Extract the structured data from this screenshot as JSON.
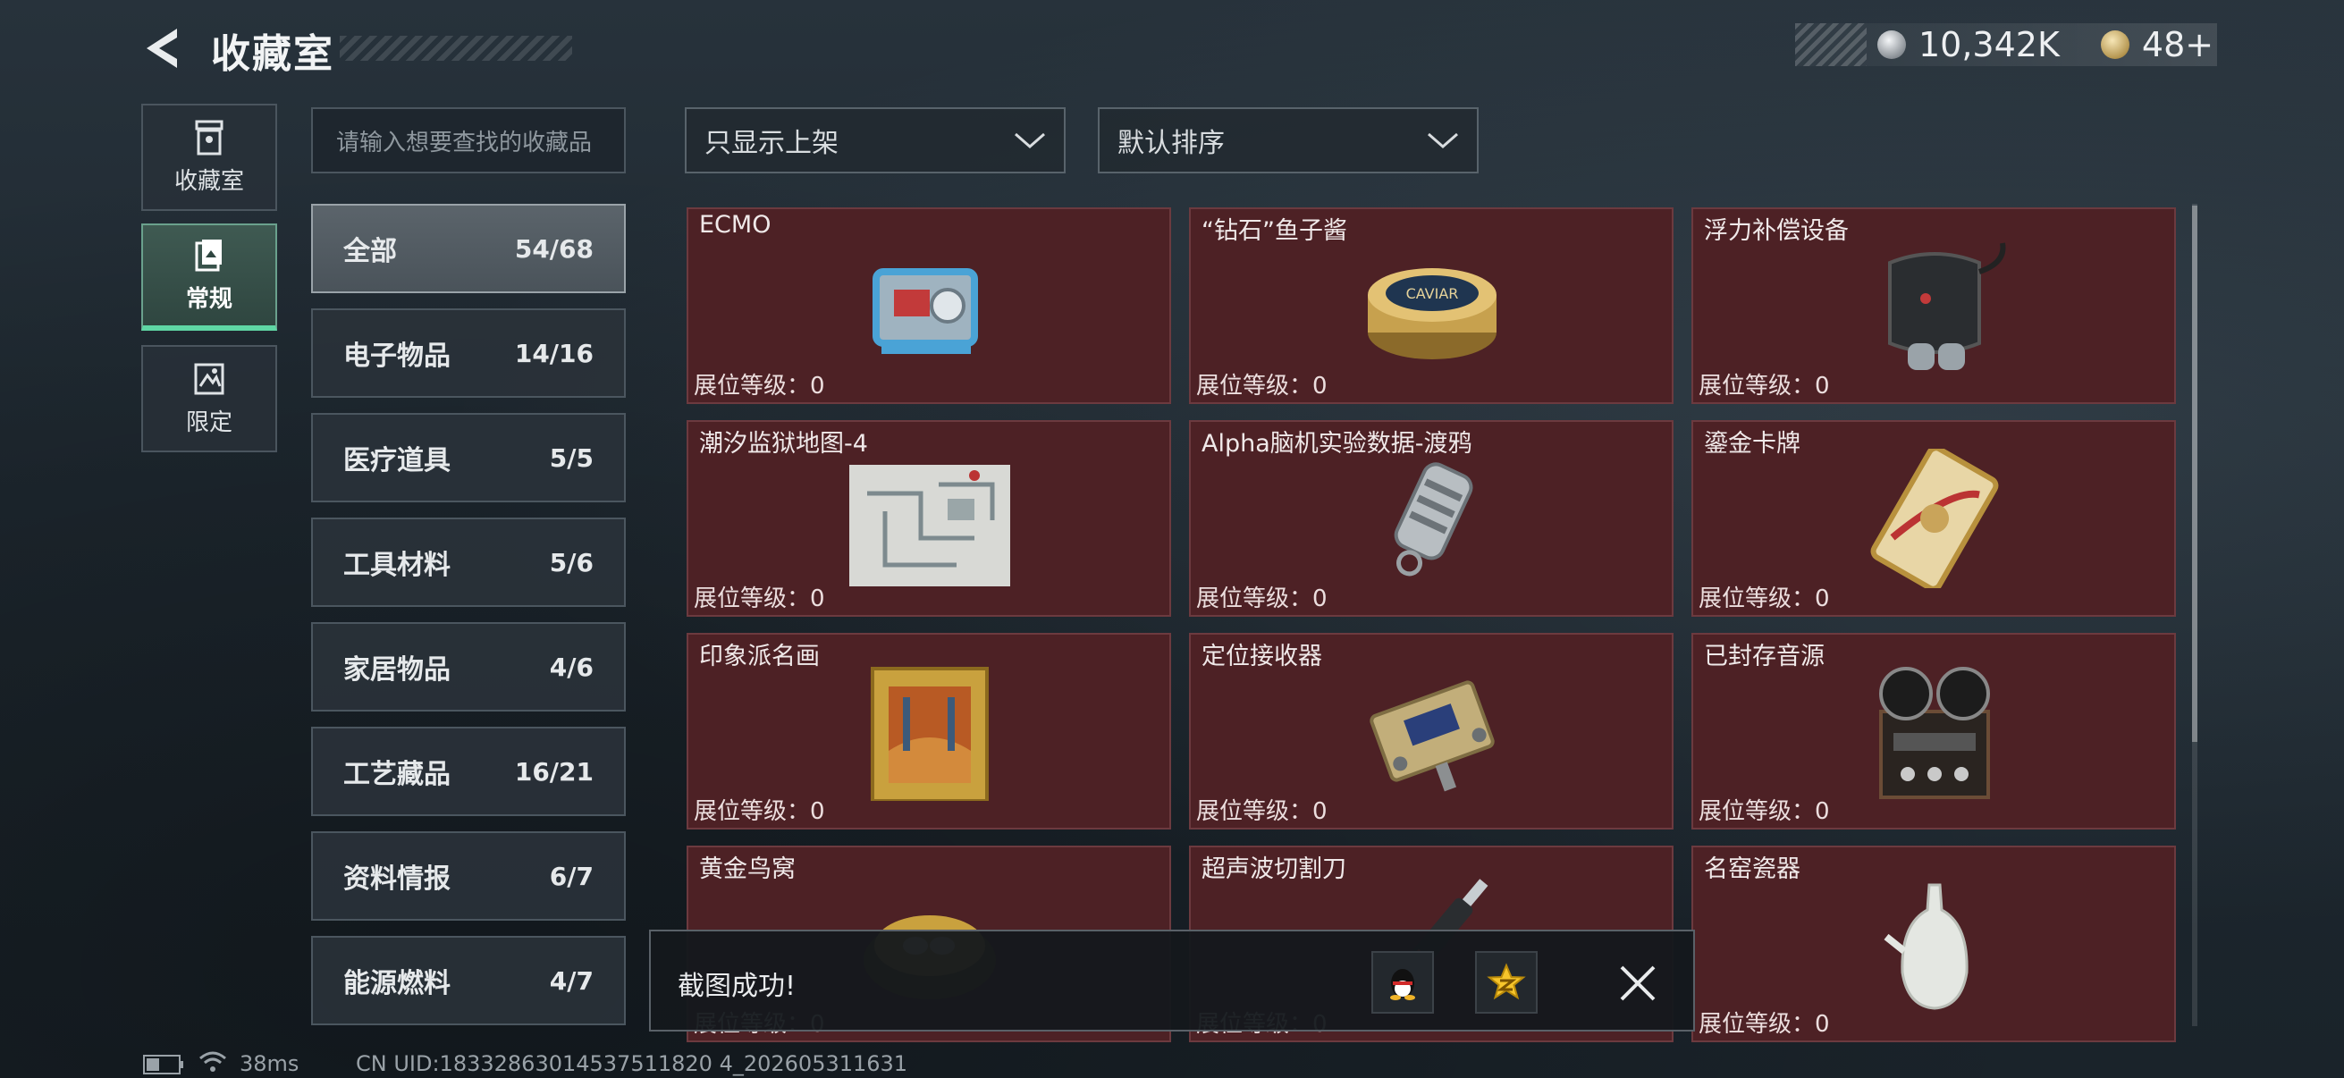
{
  "header": {
    "title": "收藏室",
    "currency_silver": "10,342K",
    "currency_gold": "48+"
  },
  "side_tabs": [
    {
      "label": "收藏室",
      "icon": "display-case-icon",
      "active": false
    },
    {
      "label": "常规",
      "icon": "card-stack-icon",
      "active": true
    },
    {
      "label": "限定",
      "icon": "limited-icon",
      "active": false
    }
  ],
  "search": {
    "placeholder": "请输入想要查找的收藏品"
  },
  "categories": [
    {
      "name": "全部",
      "count": "54/68",
      "active": true
    },
    {
      "name": "电子物品",
      "count": "14/16"
    },
    {
      "name": "医疗道具",
      "count": "5/5"
    },
    {
      "name": "工具材料",
      "count": "5/6"
    },
    {
      "name": "家居物品",
      "count": "4/6"
    },
    {
      "name": "工艺藏品",
      "count": "16/21"
    },
    {
      "name": "资料情报",
      "count": "6/7"
    },
    {
      "name": "能源燃料",
      "count": "4/7"
    }
  ],
  "filters": {
    "filter_selected": "只显示上架",
    "sort_selected": "默认排序"
  },
  "items": [
    {
      "name": "ECMO",
      "level": "展位等级：0",
      "icon": "ecmo-machine-icon"
    },
    {
      "name": "“钻石”鱼子酱",
      "level": "展位等级：0",
      "icon": "caviar-tin-icon",
      "tin_text": "CAVIAR"
    },
    {
      "name": "浮力补偿设备",
      "level": "展位等级：0",
      "icon": "diving-bcd-icon"
    },
    {
      "name": "潮汐监狱地图-4",
      "level": "展位等级：0",
      "icon": "prison-map-icon"
    },
    {
      "name": "Alpha脑机实验数据-渡鸦",
      "level": "展位等级：0",
      "icon": "data-drive-icon"
    },
    {
      "name": "鎏金卡牌",
      "level": "展位等级：0",
      "icon": "gilded-card-icon"
    },
    {
      "name": "印象派名画",
      "level": "展位等级：0",
      "icon": "framed-painting-icon"
    },
    {
      "name": "定位接收器",
      "level": "展位等级：0",
      "icon": "locator-receiver-icon"
    },
    {
      "name": "已封存音源",
      "level": "展位等级：0",
      "icon": "reel-tape-recorder-icon"
    },
    {
      "name": "黄金鸟窝",
      "level": "展位等级：0",
      "icon": "golden-nest-icon"
    },
    {
      "name": "超声波切割刀",
      "level": "展位等级：0",
      "icon": "ultrasonic-cutter-icon"
    },
    {
      "name": "名窑瓷器",
      "level": "展位等级：0",
      "icon": "porcelain-vase-icon"
    }
  ],
  "toast": {
    "message": "截图成功!"
  },
  "footer": {
    "ping": "38ms",
    "uid": "CN UID:18332863014537511820 4_202605311631"
  }
}
